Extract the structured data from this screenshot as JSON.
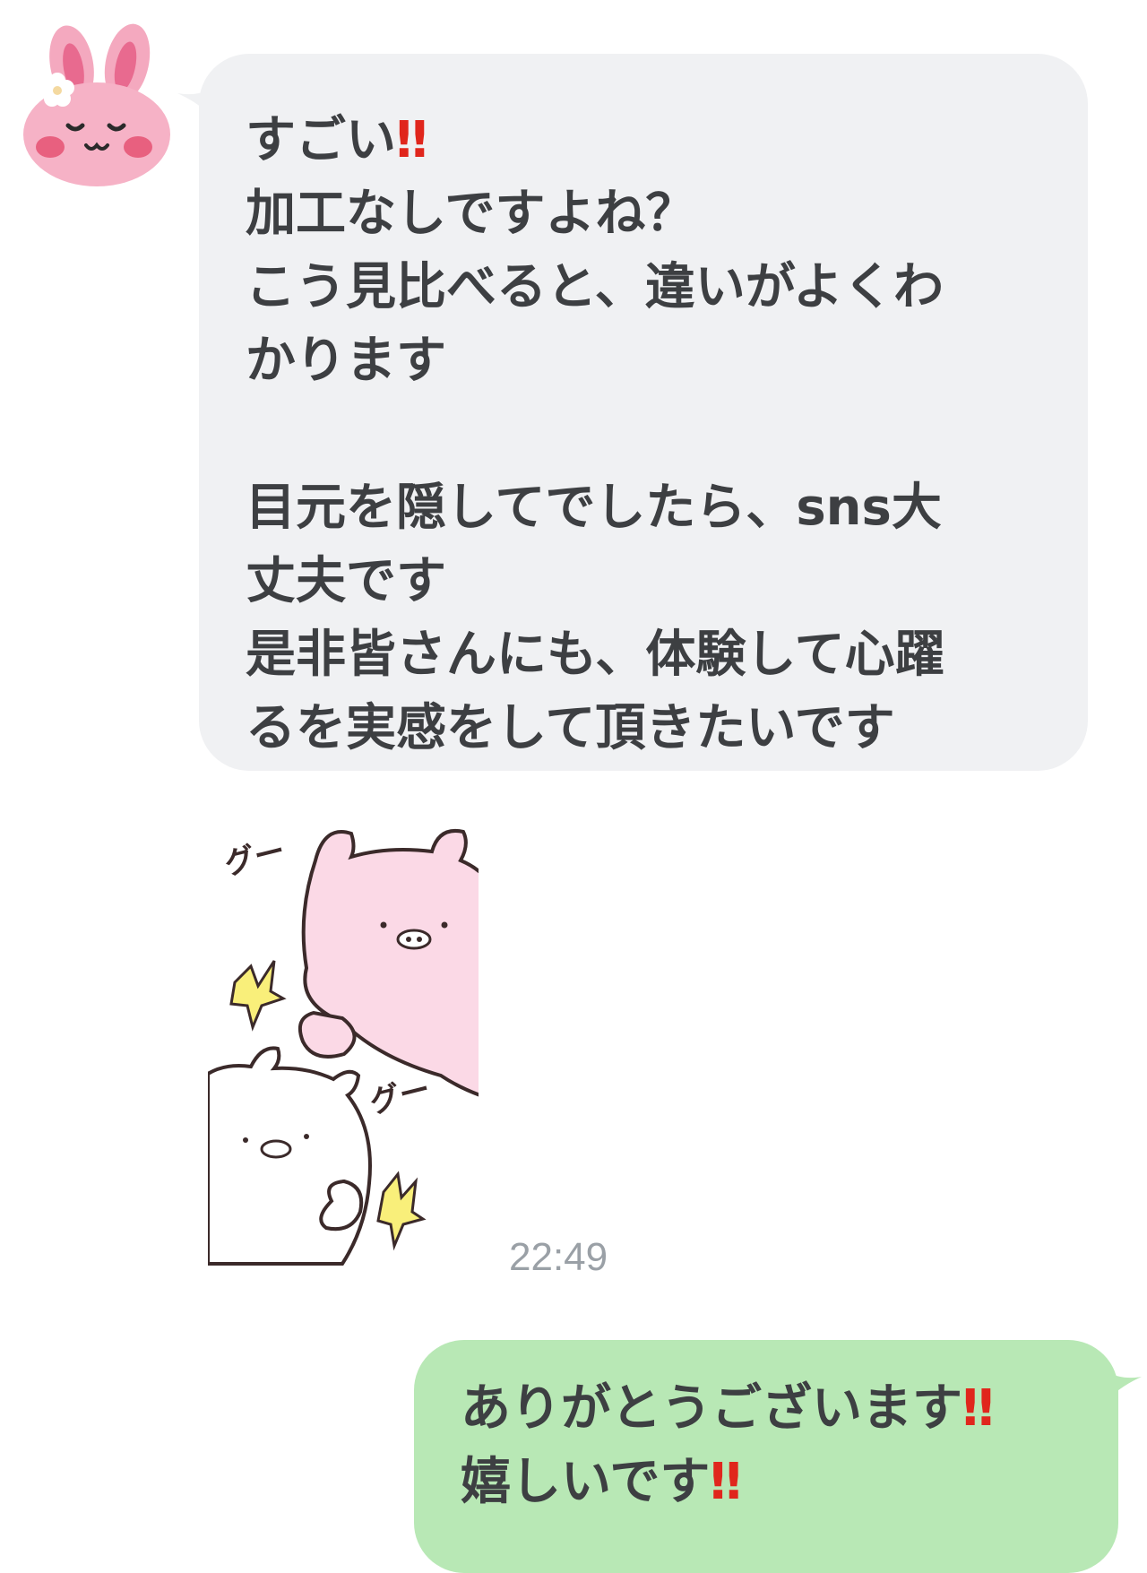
{
  "incoming_message": {
    "lines": [
      "すごい",
      "加工なしですよね？",
      "こう見比べると、違いがよくわ",
      "かります",
      "",
      "目元を隠してでしたら、sns大",
      "丈夫です",
      "是非皆さんにも、体験して心躍",
      "るを実感をして頂きたいです"
    ],
    "emphasis": "‼",
    "sender_avatar": "pink-bunny-sticker-icon"
  },
  "sticker": {
    "icon": "two-bears-pushing-sticker",
    "sound_effect_top": "グー",
    "sound_effect_bottom": "グー"
  },
  "timestamp": "22:49",
  "outgoing_message": {
    "lines": [
      "ありがとうございます",
      "嬉しいです"
    ],
    "emphasis": "‼"
  },
  "colors": {
    "incoming_bubble": "#f0f1f3",
    "outgoing_bubble": "#b8e8b5",
    "emphasis": "#e0261c",
    "timestamp": "#9aa0a6"
  }
}
